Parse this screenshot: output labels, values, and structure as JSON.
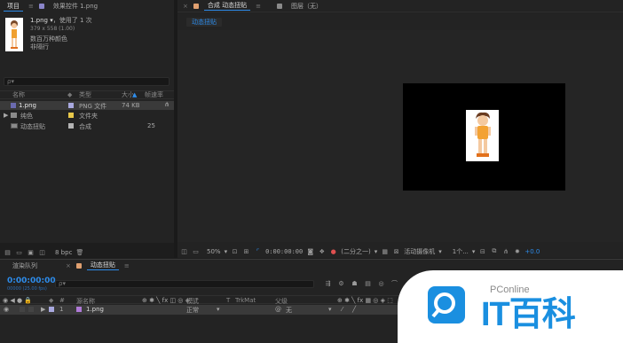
{
  "project": {
    "tab_label": "项目",
    "effects_tab_label": "效果控件 1.png",
    "file_name": "1.png ▾",
    "file_used": "，使用了 1 次",
    "file_dims": "379 x 558 (1.00)",
    "file_colors": "数百万种颜色",
    "file_interlace": "非隔行",
    "search_placeholder": "ρ▾",
    "col_name": "名称",
    "col_type": "类型",
    "col_size": "大小",
    "col_rate": "帧速率",
    "rows": [
      {
        "name": "1.png",
        "type": "PNG 文件",
        "size": "74 KB",
        "rate": "",
        "color": "#a9a9e0"
      },
      {
        "name": "纯色",
        "type": "文件夹",
        "size": "",
        "rate": "",
        "color": "#e8c84a"
      },
      {
        "name": "动态扭贴",
        "type": "合成",
        "size": "",
        "rate": "25",
        "color": "#b4b4b4"
      }
    ],
    "footer_bpc": "8 bpc"
  },
  "comp": {
    "tab_label": "合成 动态扭贴",
    "layer_tab_label": "图层（无）",
    "sub_tab": "动态扭贴",
    "zoom": "50%",
    "timecode": "0:00:00:00",
    "resolution": "(二分之一)",
    "camera": "活动摄像机",
    "views": "1个...",
    "exposure": "+0.0"
  },
  "timeline": {
    "render_tab": "渲染队列",
    "comp_tab": "动态扭贴",
    "timecode": "0:00:00:00",
    "frame_info": "00000 (25.00 fps)",
    "search_placeholder": "ρ▾",
    "col_number": "#",
    "col_source": "源名称",
    "col_mode": "模式",
    "col_t": "T",
    "col_trkmat": "TrkMat",
    "col_parent": "父级",
    "layer": {
      "number": "1",
      "name": "1.png",
      "mode": "正常",
      "parent": "无"
    }
  },
  "watermark": {
    "brand": "PConline",
    "logo_text": "IT百科"
  },
  "colors": {
    "accent_blue": "#2d8ceb",
    "comp_bg": "#000000",
    "panel_bg": "#232323"
  }
}
